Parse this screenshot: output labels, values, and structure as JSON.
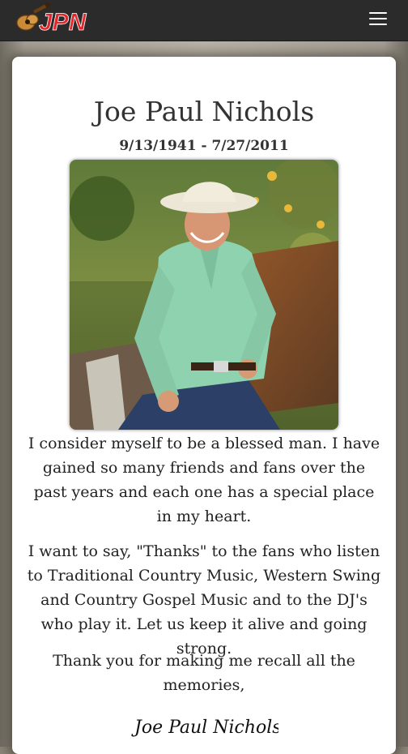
{
  "navbar": {
    "brand_text": "JPN",
    "menu_icon": "hamburger-menu-icon",
    "background": "#2b2b2b"
  },
  "profile": {
    "name": "Joe Paul Nichols",
    "dates": "9/13/1941 - 7/27/2011",
    "photo_icon": "portrait-photo"
  },
  "message": {
    "paragraphs": [
      "I consider myself to be a blessed man. I have gained so many friends and fans over the past years and each one has a special place in my heart.",
      "I want to say, \"Thanks\" to the fans who listen to Traditional Country Music, Western Swing and Country Gospel Music and to the DJ's who play it. Let us keep it alive and going strong.",
      "Thank you for making me recall all the memories,"
    ],
    "signature": "Joe Paul Nichols"
  },
  "colors": {
    "brand_blue": "#1a5fd6",
    "brand_red": "#e3262a",
    "shirt_green": "#8fd2b0"
  }
}
